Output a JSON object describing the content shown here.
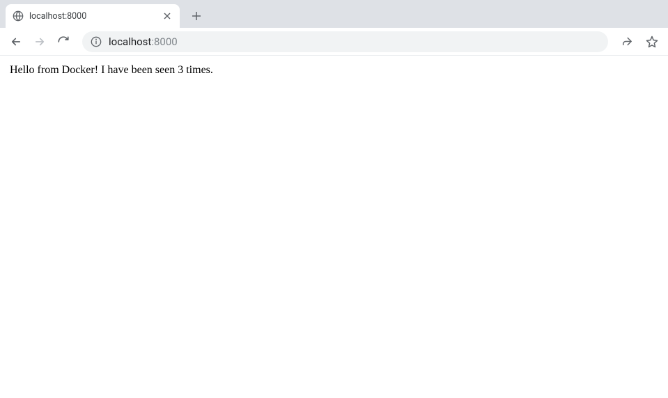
{
  "tab": {
    "title": "localhost:8000",
    "favicon": "globe-icon"
  },
  "toolbar": {
    "back_enabled": true,
    "forward_enabled": false
  },
  "address": {
    "host": "localhost",
    "port": ":8000"
  },
  "page": {
    "body_text": "Hello from Docker! I have been seen 3 times."
  }
}
